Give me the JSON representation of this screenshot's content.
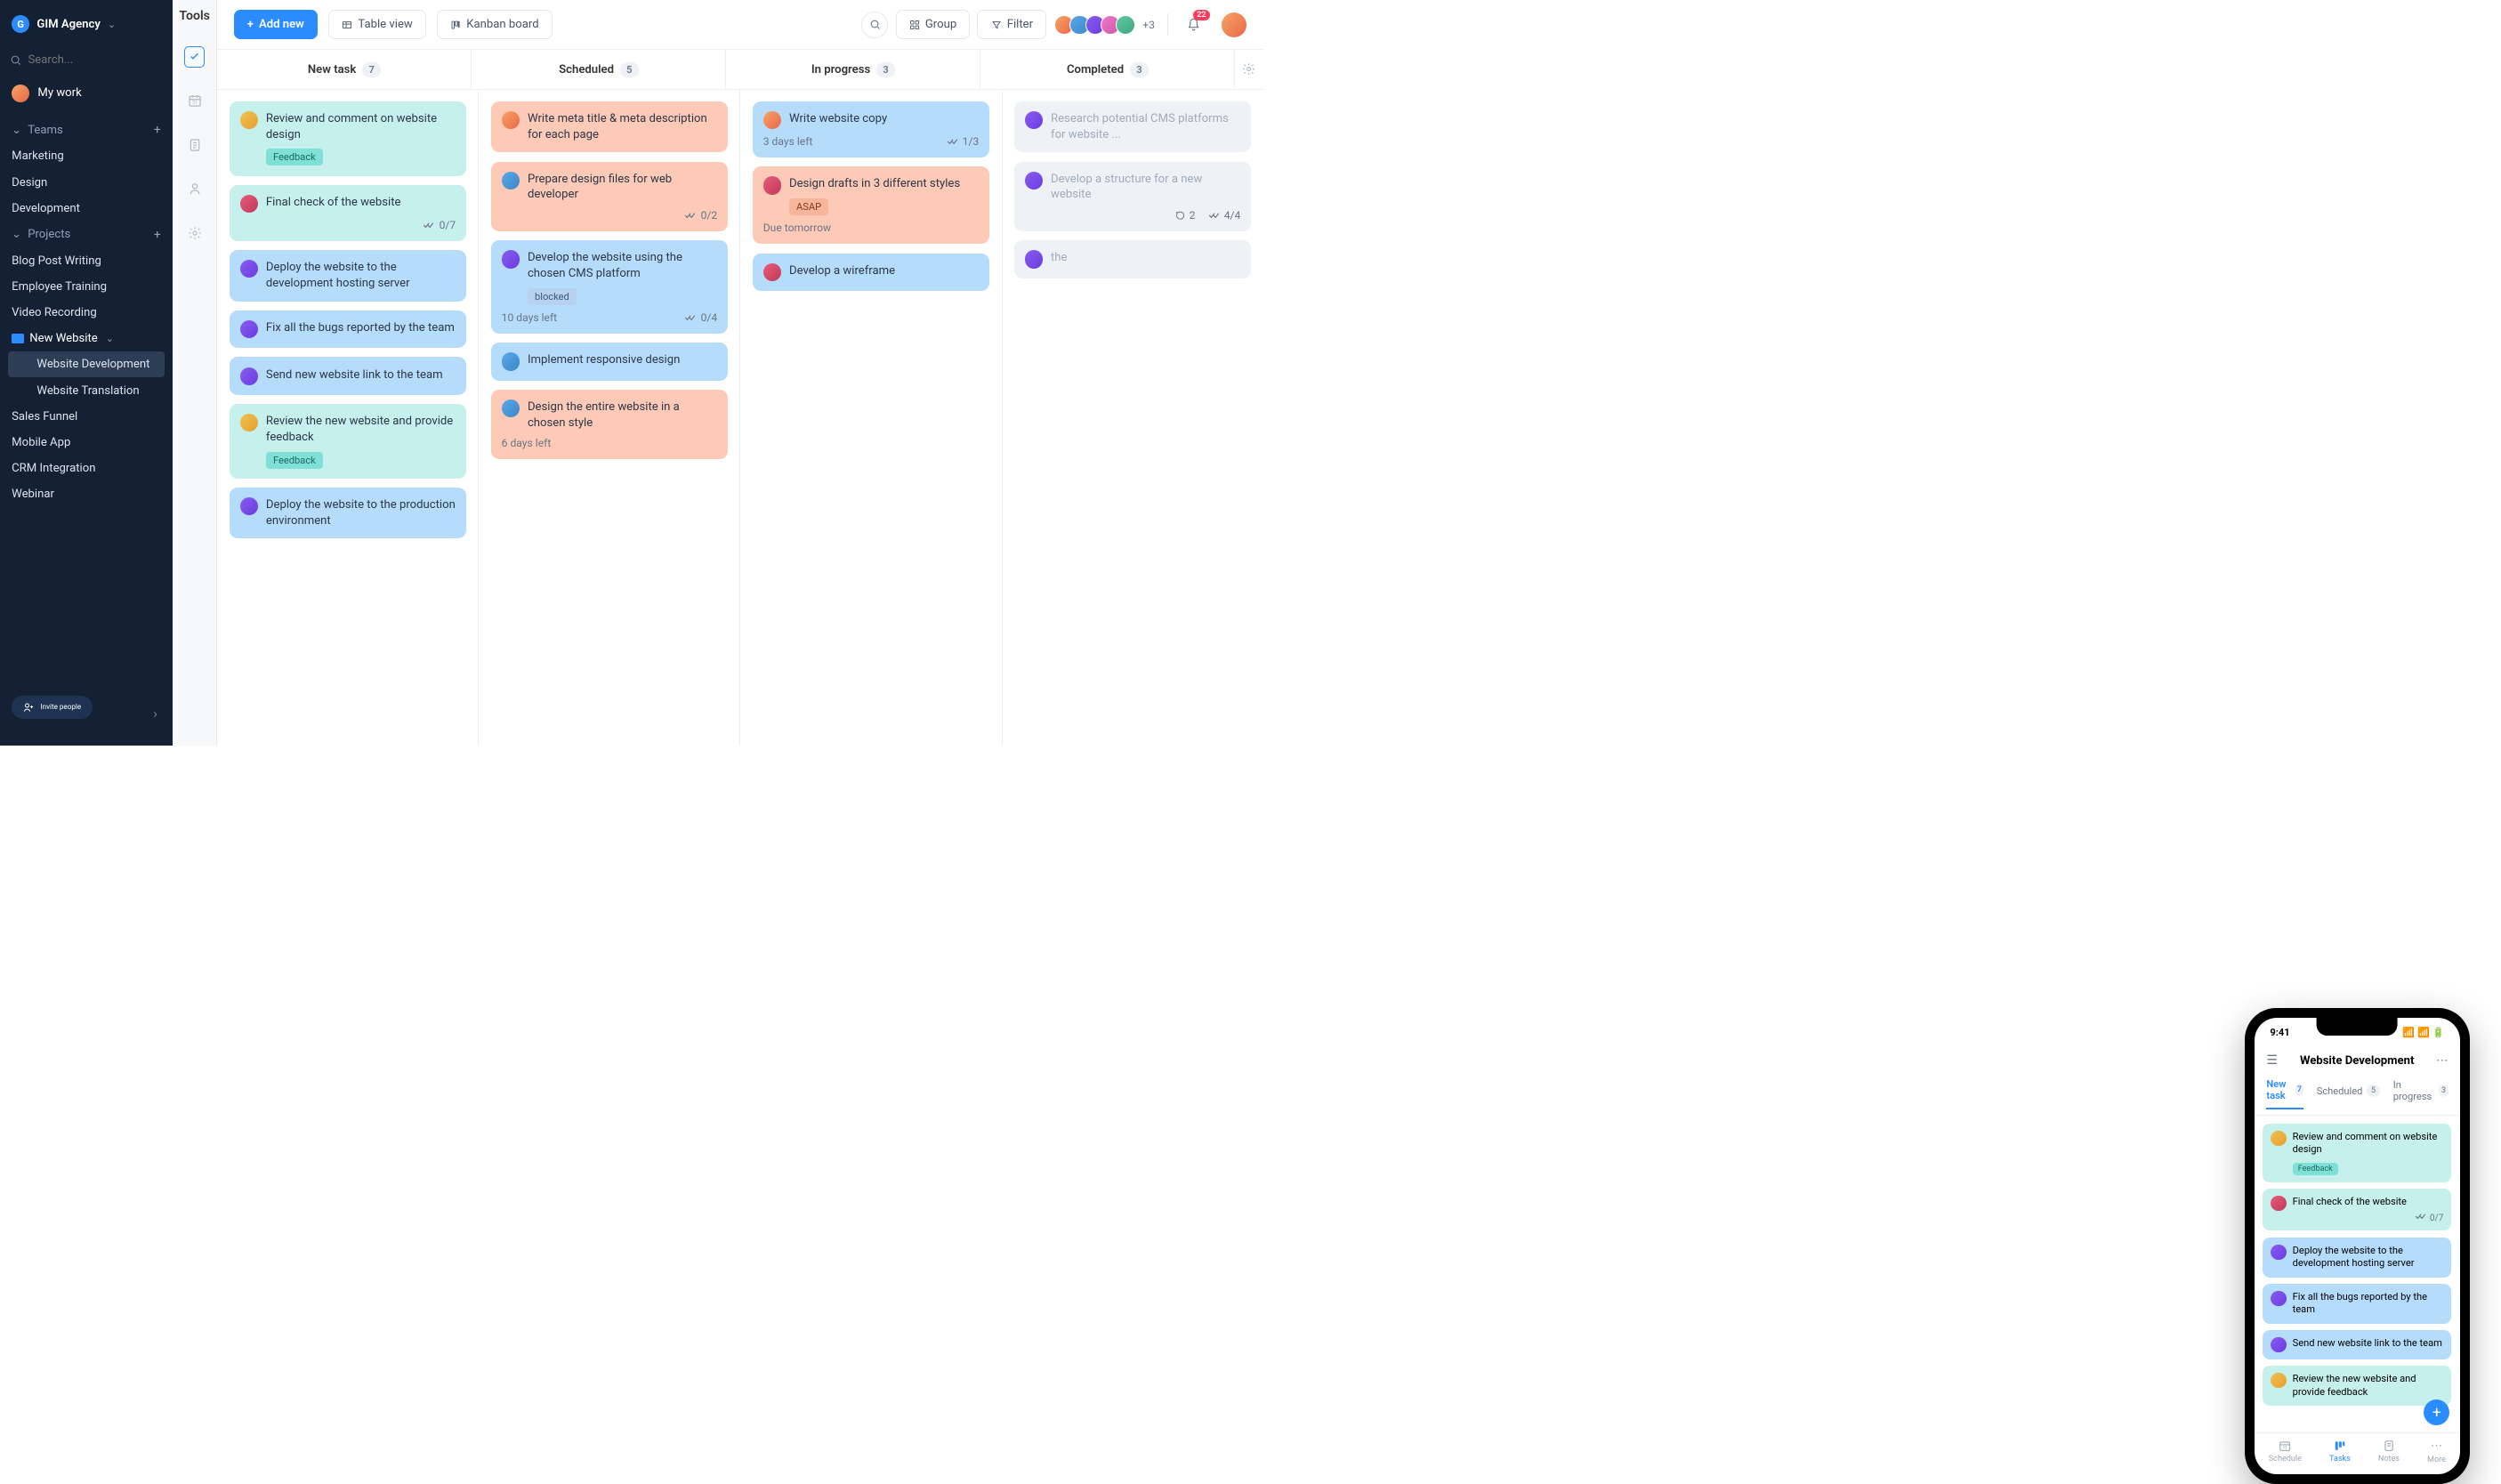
{
  "workspace": {
    "name": "GIM Agency"
  },
  "search": {
    "placeholder": "Search..."
  },
  "mywork": {
    "label": "My work"
  },
  "sections": {
    "teams": {
      "label": "Teams",
      "items": [
        "Marketing",
        "Design",
        "Development"
      ]
    },
    "projects": {
      "label": "Projects",
      "items": [
        "Blog Post Writing",
        "Employee Training",
        "Video Recording"
      ],
      "folder": "New Website",
      "children": [
        "Website Development",
        "Website Translation"
      ],
      "rest": [
        "Sales Funnel",
        "Mobile App",
        "CRM Integration",
        "Webinar"
      ]
    }
  },
  "invite": {
    "label": "Invite people"
  },
  "rail": {
    "title": "Tools"
  },
  "toolbar": {
    "add": "Add new",
    "table": "Table view",
    "kanban": "Kanban board",
    "group": "Group",
    "filter": "Filter",
    "plus_count": "+3",
    "notif_count": "22"
  },
  "columns": [
    {
      "title": "New task",
      "count": "7"
    },
    {
      "title": "Scheduled",
      "count": "5"
    },
    {
      "title": "In progress",
      "count": "3"
    },
    {
      "title": "Completed",
      "count": "3"
    }
  ],
  "cards": {
    "new": [
      {
        "title": "Review and comment on website design",
        "tag": "Feedback",
        "color": "c-teal",
        "av": "av4"
      },
      {
        "title": "Final check of the website",
        "color": "c-teal",
        "checklist": "0/7",
        "av": "av2"
      },
      {
        "title": "Deploy the website to the development hosting server",
        "color": "c-blue",
        "av": "av3"
      },
      {
        "title": "Fix all the bugs reported by the team",
        "color": "c-blue",
        "av": "av3"
      },
      {
        "title": "Send new website link to the team",
        "color": "c-blue",
        "av": "av3"
      },
      {
        "title": "Review the new website and provide feedback",
        "tag": "Feedback",
        "color": "c-teal",
        "av": "av4"
      },
      {
        "title": "Deploy the website to the production environment",
        "color": "c-blue",
        "av": "av3"
      }
    ],
    "scheduled": [
      {
        "title": "Write meta title & meta description for each page",
        "color": "c-orange",
        "av": "av1"
      },
      {
        "title": "Prepare design files for web developer",
        "color": "c-orange",
        "checklist": "0/2",
        "av": "av5"
      },
      {
        "title": "Develop the website using the chosen CMS platform",
        "color": "c-blue",
        "tag": "blocked",
        "due": "10 days left",
        "checklist": "0/4",
        "av": "av3"
      },
      {
        "title": "Implement responsive design",
        "color": "c-blue",
        "av": "av5"
      },
      {
        "title": "Design the entire website in a chosen style",
        "color": "c-orange",
        "due": "6 days left",
        "av": "av5"
      }
    ],
    "progress": [
      {
        "title": "Write website copy",
        "color": "c-blue",
        "due": "3 days left",
        "checklist": "1/3",
        "av": "av1"
      },
      {
        "title": "Design drafts in 3 different styles",
        "color": "c-orange",
        "tag": "ASAP",
        "due": "Due tomorrow",
        "av": "av2"
      },
      {
        "title": "Develop a wireframe",
        "color": "c-blue",
        "av": "av2"
      }
    ],
    "completed": [
      {
        "title": "Research potential CMS platforms for website ...",
        "color": "c-gray",
        "av": "av3"
      },
      {
        "title": "Develop a structure for a new website",
        "color": "c-gray",
        "comments": "2",
        "checklist": "4/4",
        "av": "av3"
      },
      {
        "title": "the",
        "color": "c-gray",
        "av": "av3"
      }
    ]
  },
  "phone": {
    "time": "9:41",
    "title": "Website Development",
    "tabs": [
      {
        "label": "New task",
        "count": "7"
      },
      {
        "label": "Scheduled",
        "count": "5"
      },
      {
        "label": "In progress",
        "count": "3"
      }
    ],
    "cards": [
      {
        "title": "Review and comment on website design",
        "tag": "Feedback",
        "color": "c-teal",
        "av": "av4"
      },
      {
        "title": "Final check of the website",
        "color": "c-teal",
        "checklist": "0/7",
        "av": "av2"
      },
      {
        "title": "Deploy the website to the development hosting server",
        "color": "c-blue",
        "av": "av3"
      },
      {
        "title": "Fix all the bugs reported by the team",
        "color": "c-blue",
        "av": "av3"
      },
      {
        "title": "Send new website link to the team",
        "color": "c-blue",
        "av": "av3"
      },
      {
        "title": "Review the new website and provide feedback",
        "color": "c-teal",
        "av": "av4"
      }
    ],
    "tabbar": [
      "Schedule",
      "Tasks",
      "Notes",
      "More"
    ]
  }
}
